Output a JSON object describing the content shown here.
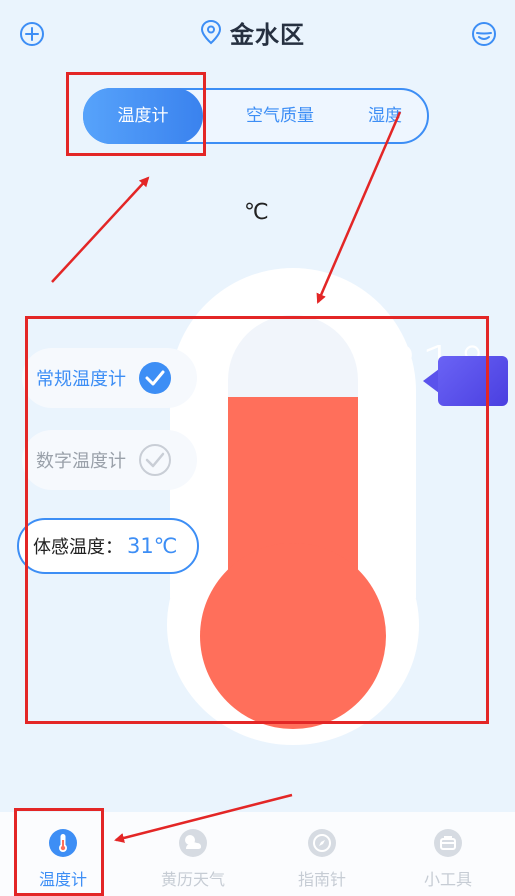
{
  "header": {
    "city": "金水区",
    "add_icon": "plus-circle-icon",
    "location_icon": "location-pin-icon",
    "profile_icon": "smiley-face-icon"
  },
  "tabs": [
    {
      "label": "温度计",
      "active": true
    },
    {
      "label": "空气质量",
      "active": false
    },
    {
      "label": "湿度",
      "active": false
    }
  ],
  "unit": "℃",
  "thermometer": {
    "big_temp": "31°",
    "fill_level": 0.72,
    "fill_color": "#ff6f5b"
  },
  "options": [
    {
      "label": "常规温度计",
      "checked": true
    },
    {
      "label": "数字温度计",
      "checked": false
    }
  ],
  "feels_like": {
    "label": "体感温度：",
    "value": "31℃"
  },
  "bottom_nav": [
    {
      "label": "温度计",
      "icon": "thermometer-icon",
      "active": true
    },
    {
      "label": "黄历天气",
      "icon": "weather-icon",
      "active": false
    },
    {
      "label": "指南针",
      "icon": "compass-icon",
      "active": false
    },
    {
      "label": "小工具",
      "icon": "toolbox-icon",
      "active": false
    }
  ],
  "colors": {
    "accent": "#3d8ef5",
    "annotation": "#e32626",
    "background": "#eaf4fd"
  }
}
